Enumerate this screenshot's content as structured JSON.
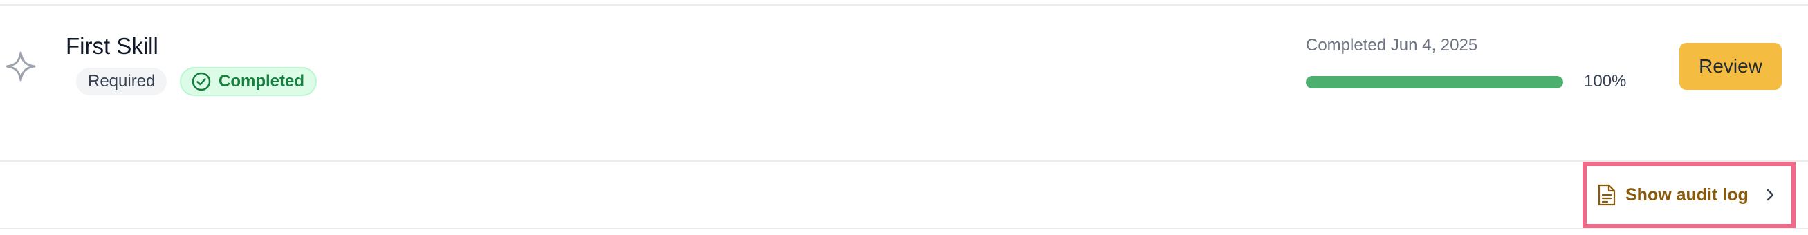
{
  "skill": {
    "title": "First Skill",
    "required_label": "Required",
    "status_label": "Completed",
    "completed_text": "Completed Jun 4, 2025",
    "progress_percent": 100,
    "progress_label": "100%",
    "review_label": "Review"
  },
  "audit": {
    "show_label": "Show audit log"
  },
  "icons": {
    "skill": "sparkle-icon",
    "status": "check-circle-icon",
    "audit": "document-icon",
    "chevron": "chevron-right-icon"
  },
  "colors": {
    "accent": "#f5bc42",
    "success": "#15803d",
    "success_bg": "#dcfce7",
    "progress": "#4caf6e",
    "audit_text": "#8a5a0b",
    "highlight": "#f06b89"
  }
}
